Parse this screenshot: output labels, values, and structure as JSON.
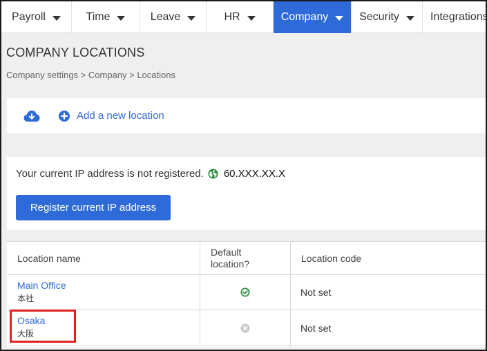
{
  "nav": {
    "items": [
      {
        "label": "Payroll"
      },
      {
        "label": "Time"
      },
      {
        "label": "Leave"
      },
      {
        "label": "HR"
      },
      {
        "label": "Company"
      },
      {
        "label": "Security"
      },
      {
        "label": "Integrations"
      }
    ],
    "active": "Company"
  },
  "page": {
    "title": "COMPANY LOCATIONS",
    "breadcrumb": "Company settings > Company > Locations"
  },
  "actions": {
    "download_icon": "cloud-download-icon",
    "add_icon": "plus-circle-icon",
    "add_label": "Add a new location"
  },
  "ip": {
    "message": "Your current IP address is not registered.",
    "icon": "globe-icon",
    "value": "60.XXX.XX.X",
    "register_label": "Register current IP address"
  },
  "table": {
    "headers": {
      "name": "Location name",
      "default_line1": "Default",
      "default_line2": "location?",
      "code": "Location code"
    },
    "rows": [
      {
        "name": "Main Office",
        "sub": "本社",
        "default": true,
        "default_icon": "check-circle-icon",
        "code": "Not set"
      },
      {
        "name": "Osaka",
        "sub": "大阪",
        "default": false,
        "default_icon": "x-circle-icon",
        "code": "Not set"
      }
    ]
  },
  "colors": {
    "accent": "#2f6bd8",
    "success": "#2e8b3e",
    "muted": "#c8c8c8",
    "highlight": "#e02020"
  }
}
